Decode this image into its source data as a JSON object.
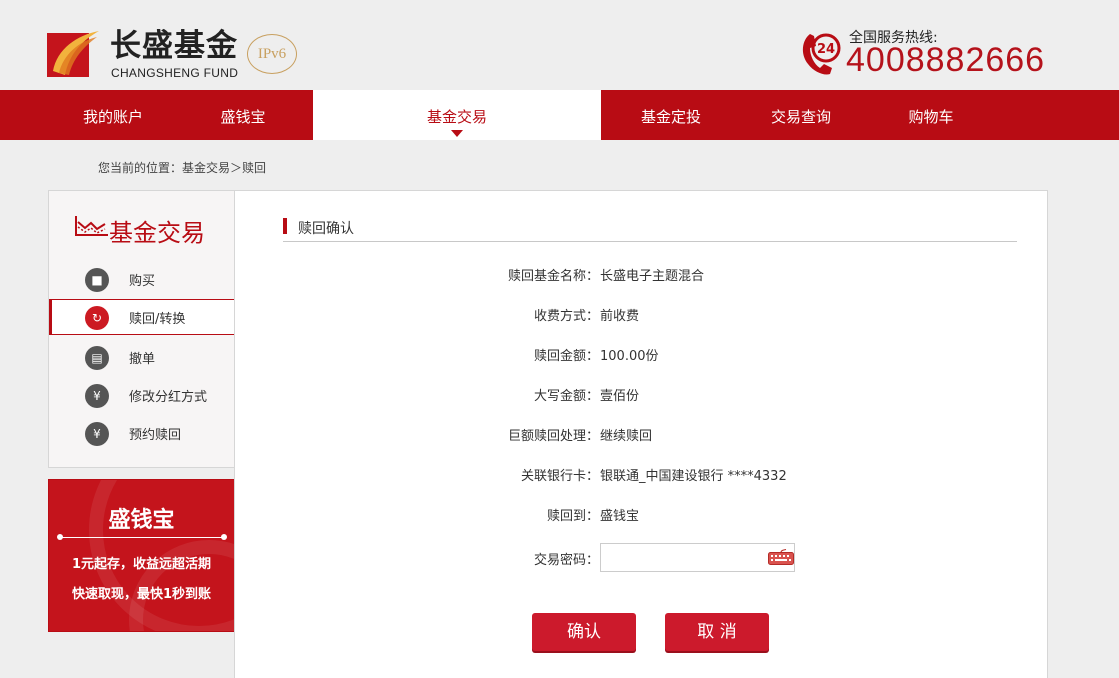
{
  "header": {
    "brand_cn": "长盛基金",
    "brand_en": "CHANGSHENG FUND",
    "ipv6": "IPv6",
    "hotline_label": "全国服务热线:",
    "hotline_number": "4008882666",
    "phone_badge": "24",
    "brand_color": "#b80c14"
  },
  "nav": {
    "items": [
      {
        "label": "我的账户"
      },
      {
        "label": "盛钱宝"
      },
      {
        "label": "基金交易"
      },
      {
        "label": "基金定投"
      },
      {
        "label": "交易查询"
      },
      {
        "label": "购物车"
      }
    ],
    "active": "基金交易"
  },
  "breadcrumb": "您当前的位置：基金交易＞赎回",
  "sidebar": {
    "title": "基金交易",
    "items": [
      {
        "label": "购买",
        "icon": "basket-icon"
      },
      {
        "label": "赎回/转换",
        "icon": "refresh-icon"
      },
      {
        "label": "撤单",
        "icon": "document-icon"
      },
      {
        "label": "修改分红方式",
        "icon": "money-icon"
      },
      {
        "label": "预约赎回",
        "icon": "money-icon"
      }
    ],
    "active": "赎回/转换"
  },
  "promo": {
    "title": "盛钱宝",
    "line1": "1元起存，收益远超活期",
    "line2": "快速取现，最快1秒到账"
  },
  "main": {
    "section_title": "赎回确认",
    "rows": [
      {
        "label": "赎回基金名称：",
        "value": "长盛电子主题混合"
      },
      {
        "label": "收费方式：",
        "value": "前收费"
      },
      {
        "label": "赎回金额：",
        "value": "100.00份"
      },
      {
        "label": "大写金额：",
        "value": "壹佰份"
      },
      {
        "label": "巨额赎回处理：",
        "value": "继续赎回"
      },
      {
        "label": "关联银行卡：",
        "value": "银联通_中国建设银行 ****4332"
      },
      {
        "label": "赎回到：",
        "value": "盛钱宝"
      }
    ],
    "password_label": "交易密码：",
    "password_value": "",
    "confirm_label": "确认",
    "cancel_label": "取 消"
  }
}
